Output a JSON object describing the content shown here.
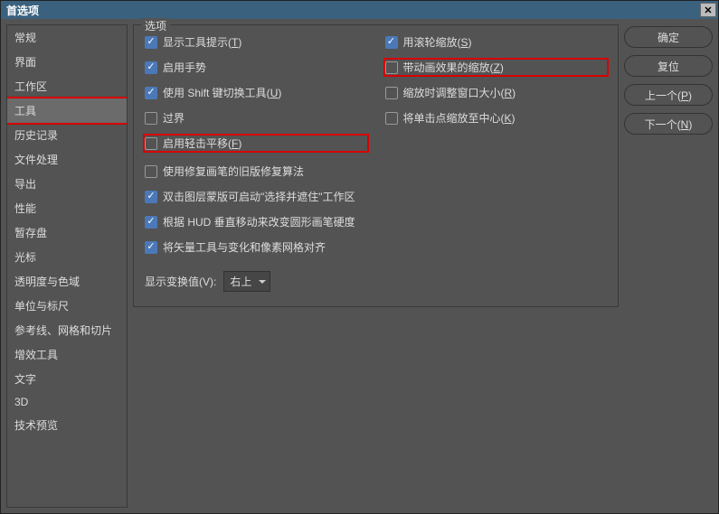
{
  "title": "首选项",
  "close_icon": "✕",
  "sidebar": {
    "selected": 3,
    "items": [
      "常规",
      "界面",
      "工作区",
      "工具",
      "历史记录",
      "文件处理",
      "导出",
      "性能",
      "暂存盘",
      "光标",
      "透明度与色域",
      "单位与标尺",
      "参考线、网格和切片",
      "增效工具",
      "文字",
      "3D",
      "技术预览"
    ]
  },
  "options": {
    "legend": "选项",
    "left": [
      {
        "label": "显示工具提示(T)",
        "checked": true,
        "hl": false
      },
      {
        "label": "启用手势",
        "checked": true,
        "hl": false
      },
      {
        "label": "使用 Shift 键切换工具(U)",
        "checked": true,
        "hl": false
      },
      {
        "label": "过界",
        "checked": false,
        "hl": false
      },
      {
        "label": "启用轻击平移(F)",
        "checked": false,
        "hl": true
      }
    ],
    "right": [
      {
        "label": "用滚轮缩放(S)",
        "checked": true,
        "hl": false
      },
      {
        "label": "带动画效果的缩放(Z)",
        "checked": false,
        "hl": true
      },
      {
        "label": "缩放时调整窗口大小(R)",
        "checked": false,
        "hl": false
      },
      {
        "label": "将单击点缩放至中心(K)",
        "checked": false,
        "hl": false
      }
    ],
    "extra": [
      {
        "label": "使用修复画笔的旧版修复算法",
        "checked": false
      },
      {
        "label": "双击图层蒙版可启动\"选择并遮住\"工作区",
        "checked": true
      },
      {
        "label": "根据 HUD 垂直移动来改变圆形画笔硬度",
        "checked": true
      },
      {
        "label": "将矢量工具与变化和像素网格对齐",
        "checked": true
      }
    ],
    "transform_label": "显示变换值(V):",
    "transform_value": "右上"
  },
  "buttons": {
    "ok": "确定",
    "reset": "复位",
    "prev": "上一个(P)",
    "next": "下一个(N)"
  }
}
